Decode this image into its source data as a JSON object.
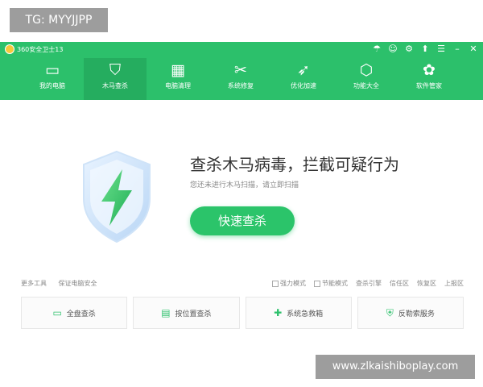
{
  "top_label": "TG: MYYJJPP",
  "titlebar": {
    "app_name": "360安全卫士13",
    "buttons": {
      "skin": "☂",
      "account": "☺",
      "settings": "⚙",
      "feedback": "⬆",
      "menu": "☰",
      "minimize": "–",
      "close": "✕"
    }
  },
  "nav": {
    "items": [
      {
        "label": "我的电脑",
        "icon": "monitor-icon",
        "glyph": "▭"
      },
      {
        "label": "木马查杀",
        "icon": "shield-bolt-icon",
        "glyph": "⛉"
      },
      {
        "label": "电脑清理",
        "icon": "broom-icon",
        "glyph": "▦"
      },
      {
        "label": "系统修复",
        "icon": "wrench-icon",
        "glyph": "✂"
      },
      {
        "label": "优化加速",
        "icon": "rocket-icon",
        "glyph": "➶"
      },
      {
        "label": "功能大全",
        "icon": "cube-icon",
        "glyph": "⬡"
      },
      {
        "label": "软件管家",
        "icon": "apps-icon",
        "glyph": "✿"
      }
    ]
  },
  "main": {
    "headline": "查杀木马病毒，拦截可疑行为",
    "subline": "您还未进行木马扫描，请立即扫描",
    "quick_scan": "快速查杀"
  },
  "tools": {
    "left": [
      "更多工具",
      "保证电脑安全"
    ],
    "right": [
      {
        "label": "强力模式",
        "checkbox": true
      },
      {
        "label": "节能模式",
        "checkbox": true
      },
      {
        "label": "查杀引擎",
        "checkbox": false
      },
      {
        "label": "信任区",
        "checkbox": false
      },
      {
        "label": "恢复区",
        "checkbox": false
      },
      {
        "label": "上报区",
        "checkbox": false
      }
    ]
  },
  "cards": [
    {
      "label": "全盘查杀",
      "glyph": "▭"
    },
    {
      "label": "按位置查杀",
      "glyph": "▤"
    },
    {
      "label": "系统急救箱",
      "glyph": "✚"
    },
    {
      "label": "反勒索服务",
      "glyph": "⛨"
    }
  ],
  "watermark": "www.zlkaishiboplay.com",
  "colors": {
    "brand_green": "#2cc06b",
    "active_tab": "#25ad5f",
    "button_green": "#2bc46a"
  }
}
